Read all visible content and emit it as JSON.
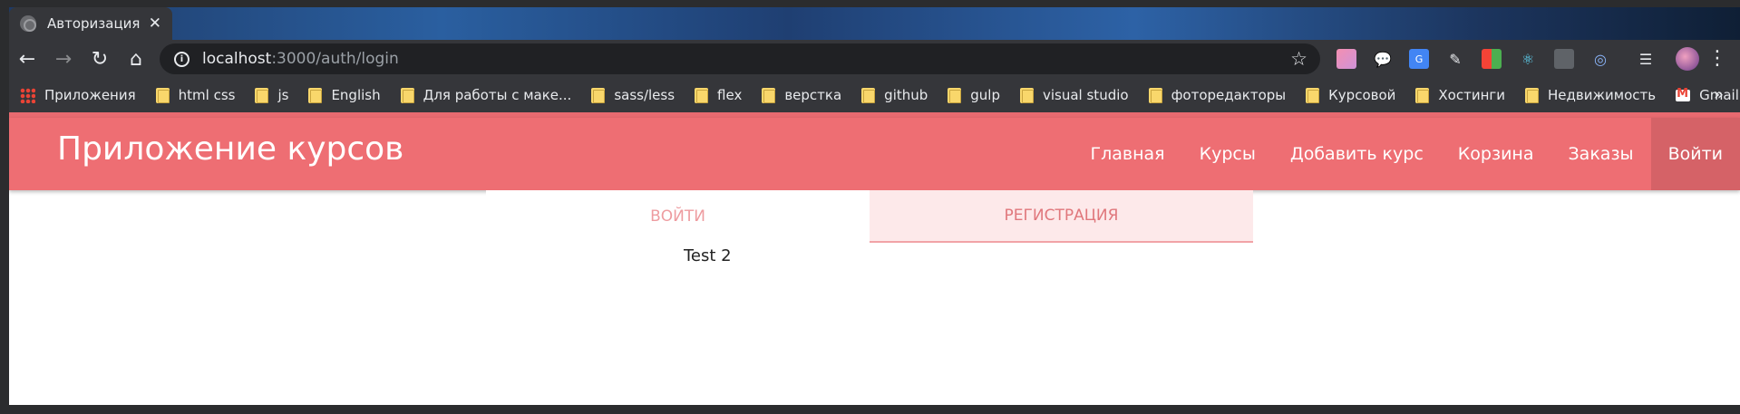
{
  "browser": {
    "tab_title": "Авторизация",
    "tab_close": "✕",
    "url_host": "localhost",
    "url_path": ":3000/auth/login",
    "star": "☆",
    "menu": "⋮"
  },
  "toolbar": {
    "back": "←",
    "forward": "→",
    "reload": "↻",
    "home": "⌂"
  },
  "bookmarks": {
    "apps_label": "Приложения",
    "folders": [
      "html css",
      "js",
      "English",
      "Для работы с маке...",
      "sass/less",
      "flex",
      "верстка",
      "github",
      "gulp",
      "visual studio",
      "фоторедакторы",
      "Курсовой",
      "Хостинги",
      "Недвижимость"
    ],
    "gmail_label": "Gmail",
    "more": "»"
  },
  "page": {
    "brand": "Приложение курсов",
    "nav": [
      "Главная",
      "Курсы",
      "Добавить курс",
      "Корзина",
      "Заказы",
      "Войти"
    ],
    "tabs": {
      "login": "Войти",
      "register": "Регистрация"
    },
    "content": "Test 2"
  },
  "colors": {
    "accent": "#ee6e73",
    "tab_active_bg": "#fde9ea"
  }
}
